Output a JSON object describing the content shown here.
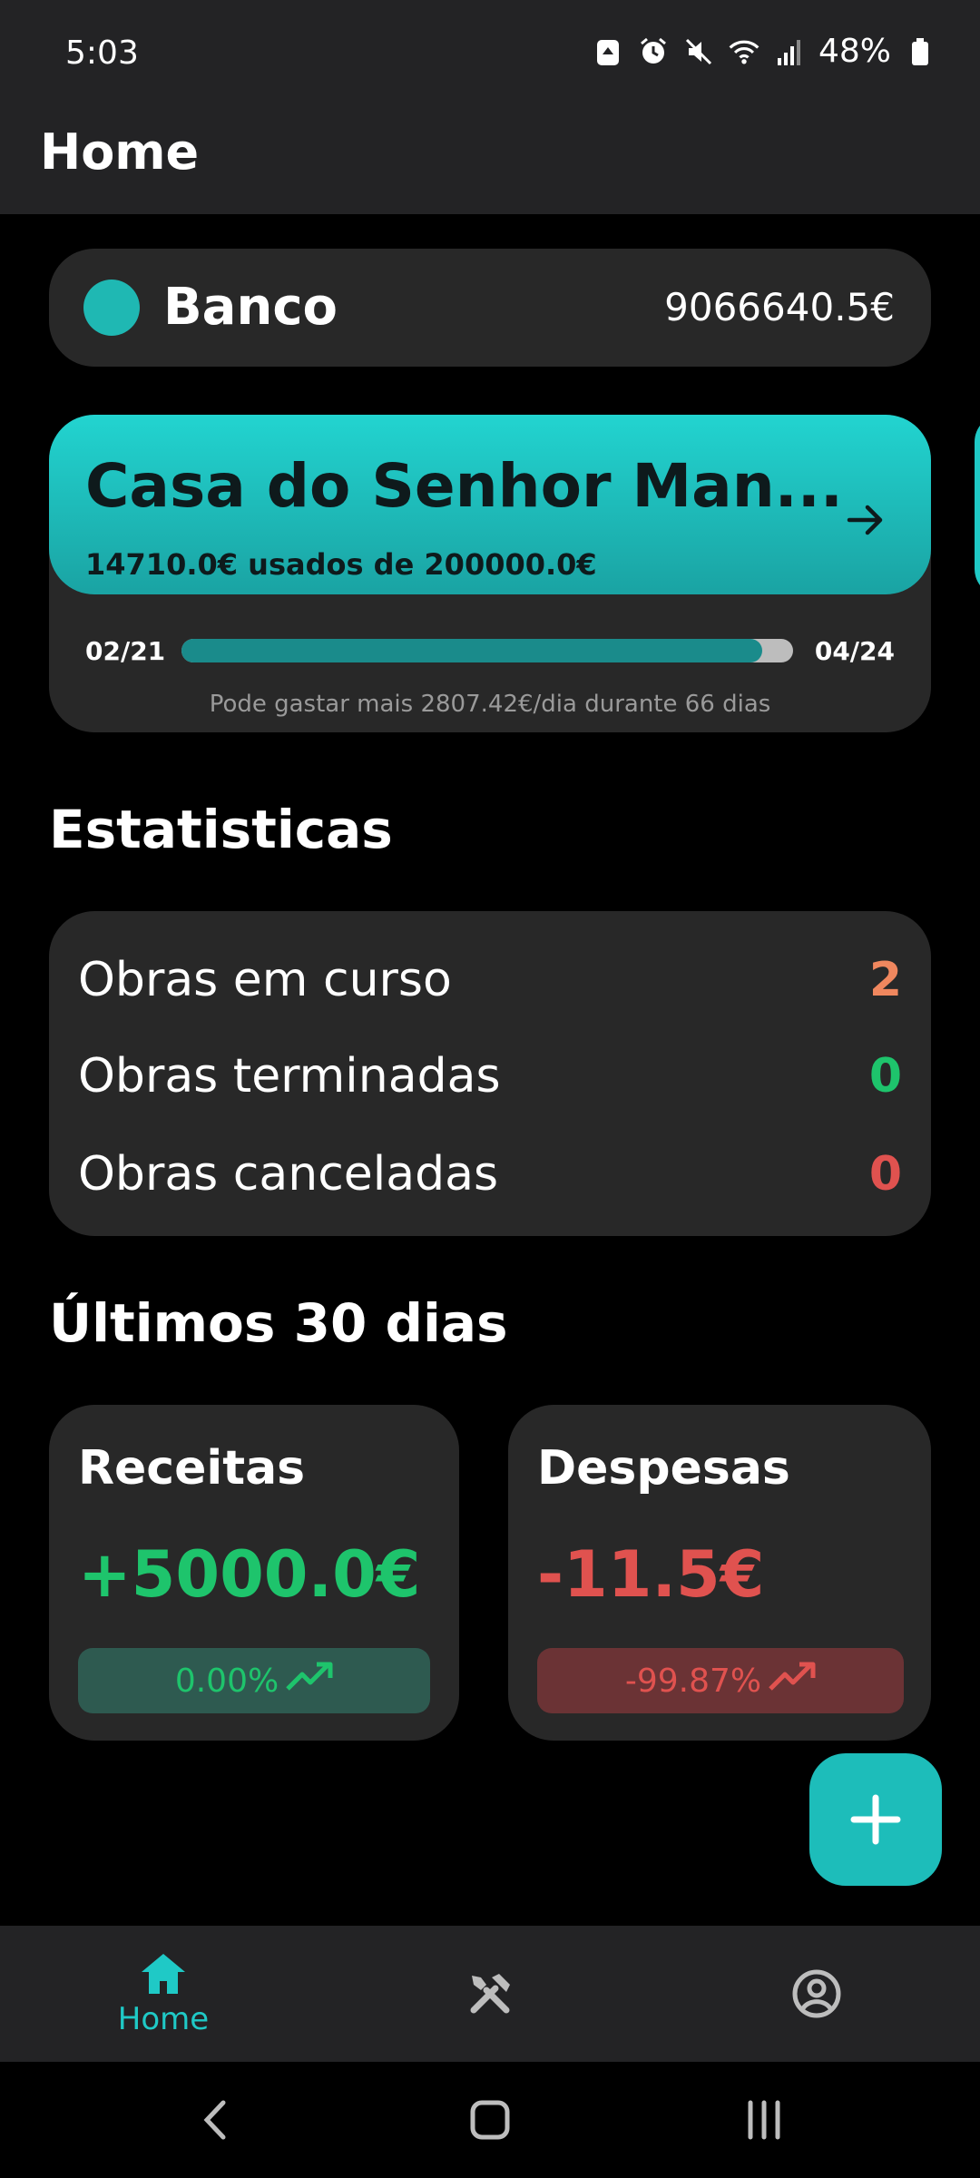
{
  "status_bar": {
    "time": "5:03",
    "battery": "48%",
    "icons": [
      "recycle-icon",
      "alarm-icon",
      "mute-icon",
      "wifi-icon",
      "signal-icon",
      "battery-icon"
    ]
  },
  "app_bar": {
    "title": "Home"
  },
  "bank": {
    "name": "Banco",
    "balance": "9066640.5€",
    "dot_color": "#1fb8b3"
  },
  "project": {
    "title": "Casa do Senhor Man...",
    "usage": "14710.0€ usados de 200000.0€",
    "start": "02/21",
    "end": "04/24",
    "progress": 0.95,
    "note": "Pode gastar mais 2807.42€/dia durante 66 dias"
  },
  "stats": {
    "title": "Estatisticas",
    "rows": [
      {
        "label": "Obras em curso",
        "value": "2",
        "color": "#f0875e"
      },
      {
        "label": "Obras terminadas",
        "value": "0",
        "color": "#1ec46c"
      },
      {
        "label": "Obras canceladas",
        "value": "0",
        "color": "#e0524f"
      }
    ]
  },
  "last30": {
    "title": "Últimos 30 dias",
    "income": {
      "title": "Receitas",
      "amount": "+5000.0€",
      "change": "0.00%",
      "color": "#1ec46c"
    },
    "expense": {
      "title": "Despesas",
      "amount": "-11.5€",
      "change": "-99.87%",
      "color": "#e0524f"
    }
  },
  "bottom_nav": {
    "items": [
      {
        "label": "Home",
        "icon": "home-icon",
        "active": true
      },
      {
        "label": "",
        "icon": "tools-icon",
        "active": false
      },
      {
        "label": "",
        "icon": "profile-icon",
        "active": false
      }
    ]
  },
  "colors": {
    "accent": "#1fc9c6",
    "card": "#282828",
    "bar": "#232325"
  }
}
